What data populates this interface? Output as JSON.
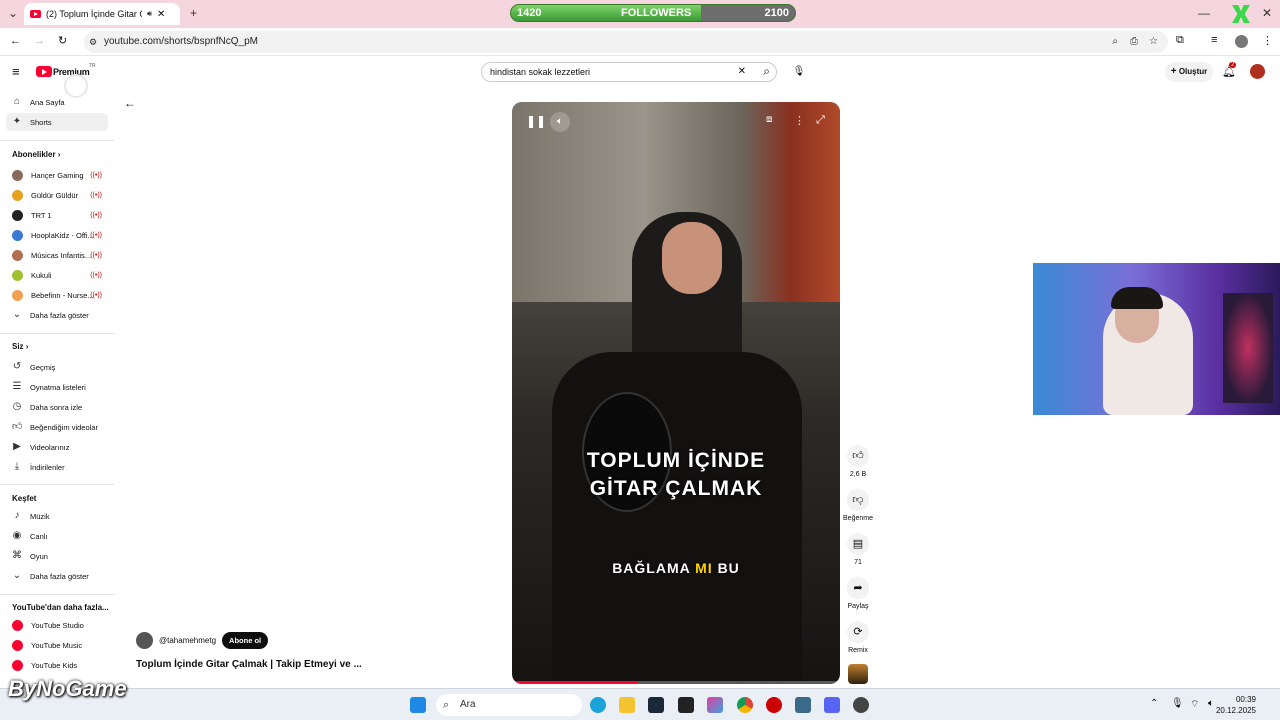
{
  "browser": {
    "tab_title": "(2) Toplum İçinde Gitar Çal",
    "url": "youtube.com/shorts/bspnfNcQ_pM"
  },
  "overlay": {
    "followers_current": "1420",
    "followers_label": "FOLLOWERS",
    "followers_goal": "2100",
    "followers_progress": 0.67,
    "brand": "ByNoGame"
  },
  "masthead": {
    "logo": "Premium",
    "logo_region": "TR",
    "search_value": "hindistan sokak lezzetleri",
    "create_label": "Oluştur",
    "notifications": "2"
  },
  "sidebar": {
    "top": [
      {
        "label": "Ana Sayfa",
        "icon": "home-icon"
      },
      {
        "label": "Shorts",
        "icon": "shorts-icon"
      }
    ],
    "subs_head": "Abonelikler",
    "subs": [
      {
        "label": "Hançer Gaming",
        "color": "#8a6a5a"
      },
      {
        "label": "Güldür Güldür",
        "color": "#e8a020"
      },
      {
        "label": "TRT 1",
        "color": "#222222"
      },
      {
        "label": "HooplaKidz - Offi...",
        "color": "#3a7ad0"
      },
      {
        "label": "Músicas Infantis...",
        "color": "#b07050"
      },
      {
        "label": "Kukuli",
        "color": "#a0c030"
      },
      {
        "label": "Bebefinn - Nurse...",
        "color": "#f0a050"
      }
    ],
    "subs_more": "Daha fazla göster",
    "you_head": "Siz",
    "you": [
      {
        "label": "Geçmiş",
        "icon": "history-icon"
      },
      {
        "label": "Oynatma listeleri",
        "icon": "playlists-icon"
      },
      {
        "label": "Daha sonra izle",
        "icon": "watch-later-icon"
      },
      {
        "label": "Beğendiğim videolar",
        "icon": "liked-icon"
      },
      {
        "label": "Videolarınız",
        "icon": "your-videos-icon"
      },
      {
        "label": "İndirilenler",
        "icon": "downloads-icon"
      }
    ],
    "explore_head": "Keşfet",
    "explore": [
      {
        "label": "Müzik",
        "icon": "music-icon"
      },
      {
        "label": "Canlı",
        "icon": "live-icon"
      },
      {
        "label": "Oyun",
        "icon": "gaming-icon"
      },
      {
        "label": "Daha fazla göster",
        "icon": "chevron-down-icon"
      }
    ],
    "more_head": "YouTube'dan daha fazla...",
    "more": [
      {
        "label": "YouTube Studio"
      },
      {
        "label": "YouTube Music"
      },
      {
        "label": "YouTube Kids"
      }
    ]
  },
  "video": {
    "caption_line1": "TOPLUM İÇİNDE",
    "caption_line2": "GİTAR ÇALMAK",
    "subtitle_a": "BAĞLAMA",
    "subtitle_b": "MI",
    "subtitle_c": "BU",
    "channel": "@tahamehmetg",
    "subscribe": "Abone ol",
    "title": "Toplum İçinde Gitar Çalmak | Takip Etmeyi ve ..."
  },
  "actions": {
    "likes": "2,6 B",
    "dislike": "Beğenme",
    "comments": "71",
    "share": "Paylaş",
    "remix": "Remix"
  },
  "taskbar": {
    "search": "Ara",
    "time": "00:39",
    "date": "20.12.2025"
  }
}
